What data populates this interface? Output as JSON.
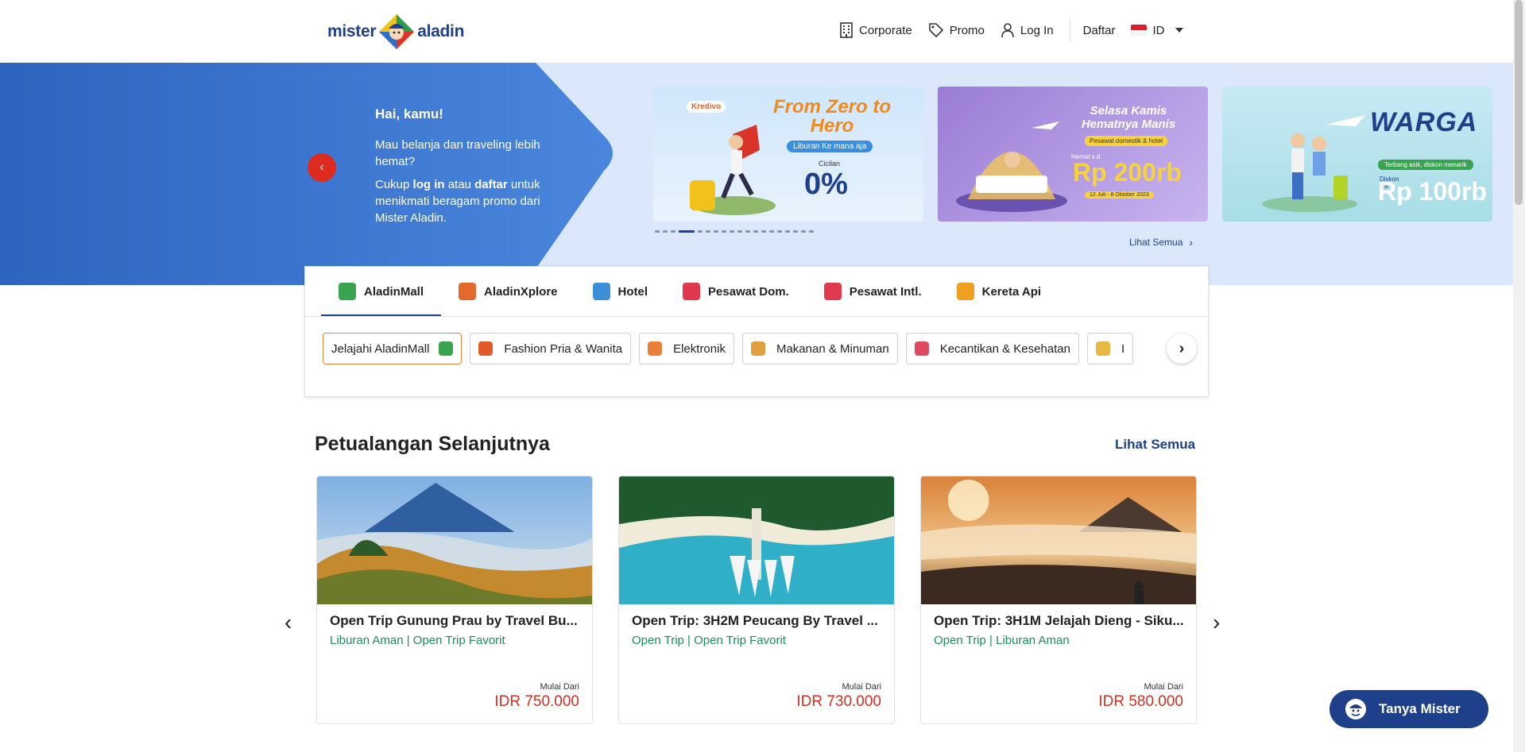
{
  "header": {
    "logo_left": "mister",
    "logo_right": "aladin",
    "nav": {
      "corporate": "Corporate",
      "promo": "Promo",
      "login": "Log In",
      "register": "Daftar",
      "language": "ID"
    }
  },
  "hero": {
    "title": "Hai, kamu!",
    "line1": "Mau belanja dan traveling lebih hemat?",
    "line2_pre": "Cukup ",
    "line2_bold1": "log in",
    "line2_mid": " atau ",
    "line2_bold2": "daftar",
    "line2_post": " untuk menikmati beragam promo dari Mister Aladin.",
    "prev_icon": "chevron-left-icon",
    "see_all": "Lihat Semua",
    "banners": [
      {
        "brand": "Kredivo",
        "headline": "From Zero to Hero",
        "sub": "Liburan Ke mana aja",
        "label": "Cicilan",
        "big": "0%"
      },
      {
        "headline": "Selasa Kamis Hematnya Manis",
        "sub": "Pesawat domestik & hotel",
        "label": "Hemat s.d",
        "big": "Rp 200rb",
        "date": "12 Juli - 8 Oktober 2023"
      },
      {
        "headline": "WARGA",
        "sub": "Terbang asik, diskon menarik",
        "label": "Diskon s.d",
        "big": "Rp 100rb"
      }
    ],
    "dots_total": 19,
    "dot_active": 3
  },
  "tabs": [
    {
      "label": "AladinMall",
      "active": true,
      "color": "#3aa34f"
    },
    {
      "label": "AladinXplore",
      "active": false,
      "color": "#e26a2c"
    },
    {
      "label": "Hotel",
      "active": false,
      "color": "#3b8fd6"
    },
    {
      "label": "Pesawat Dom.",
      "active": false,
      "color": "#e0384c"
    },
    {
      "label": "Pesawat Intl.",
      "active": false,
      "color": "#e0384c"
    },
    {
      "label": "Kereta Api",
      "active": false,
      "color": "#f0a020"
    }
  ],
  "chips": [
    {
      "label": "Jelajahi AladinMall",
      "selected": true,
      "color": "#3aa34f"
    },
    {
      "label": "Fashion Pria & Wanita",
      "selected": false,
      "color": "#e05a2a"
    },
    {
      "label": "Elektronik",
      "selected": false,
      "color": "#e8803a"
    },
    {
      "label": "Makanan & Minuman",
      "selected": false,
      "color": "#e0a040"
    },
    {
      "label": "Kecantikan & Kesehatan",
      "selected": false,
      "color": "#e04a60"
    },
    {
      "label": "I",
      "selected": false,
      "color": "#e8b840"
    }
  ],
  "section": {
    "title": "Petualangan Selanjutnya",
    "see_all": "Lihat Semua",
    "products": [
      {
        "title": "Open Trip Gunung Prau by Travel Bu...",
        "tags": "Liburan Aman | Open Trip Favorit",
        "from": "Mulai Dari",
        "price": "IDR 750.000"
      },
      {
        "title": "Open Trip: 3H2M Peucang By Travel ...",
        "tags": "Open Trip | Open Trip Favorit",
        "from": "Mulai Dari",
        "price": "IDR 730.000"
      },
      {
        "title": "Open Trip: 3H1M Jelajah Dieng - Siku...",
        "tags": "Open Trip | Liburan Aman",
        "from": "Mulai Dari",
        "price": "IDR 580.000"
      }
    ]
  },
  "chat": {
    "label": "Tanya Mister"
  },
  "colors": {
    "brand": "#1e3f8a",
    "price": "#d03222",
    "tag": "#1e8c5a",
    "accent": "#dd2b1f"
  }
}
